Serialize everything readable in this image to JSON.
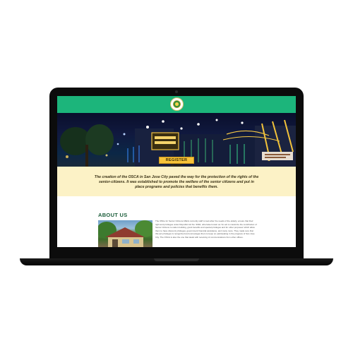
{
  "website": {
    "hero": {
      "button_label": "REGISTER NOW!"
    },
    "intro": {
      "text": "The creation of the OSCA in San Jose City paved the way for the protection of the rights of the senior-citizens. It was established to promote the welfare of the senior citizens and put in place programs and policies that benefits them."
    },
    "about": {
      "title": "ABOUT US",
      "text": "The Office for Senior Citizens Affairs currently staff to look after the needs of the elderly, ensure that their right and privileges under Republic Act No. 9994, otherwise known as 'An act to maximize the contribution of Senior Citizens to nation building, grant benefits and special privileges and for other purposes' which allow them to have discount privileges, government financial assistance, and many more. They made sure that this act privileges is recognized and encourages them to keep on participating in the progress of San Jose City. The OSCA is also the one that deals with receiving of communications from other offices."
    },
    "colors": {
      "header_green": "#1cb57b",
      "intro_band": "#fcf2c6",
      "button_yellow": "#f6c33a",
      "title_green": "#1b5d3a"
    }
  }
}
